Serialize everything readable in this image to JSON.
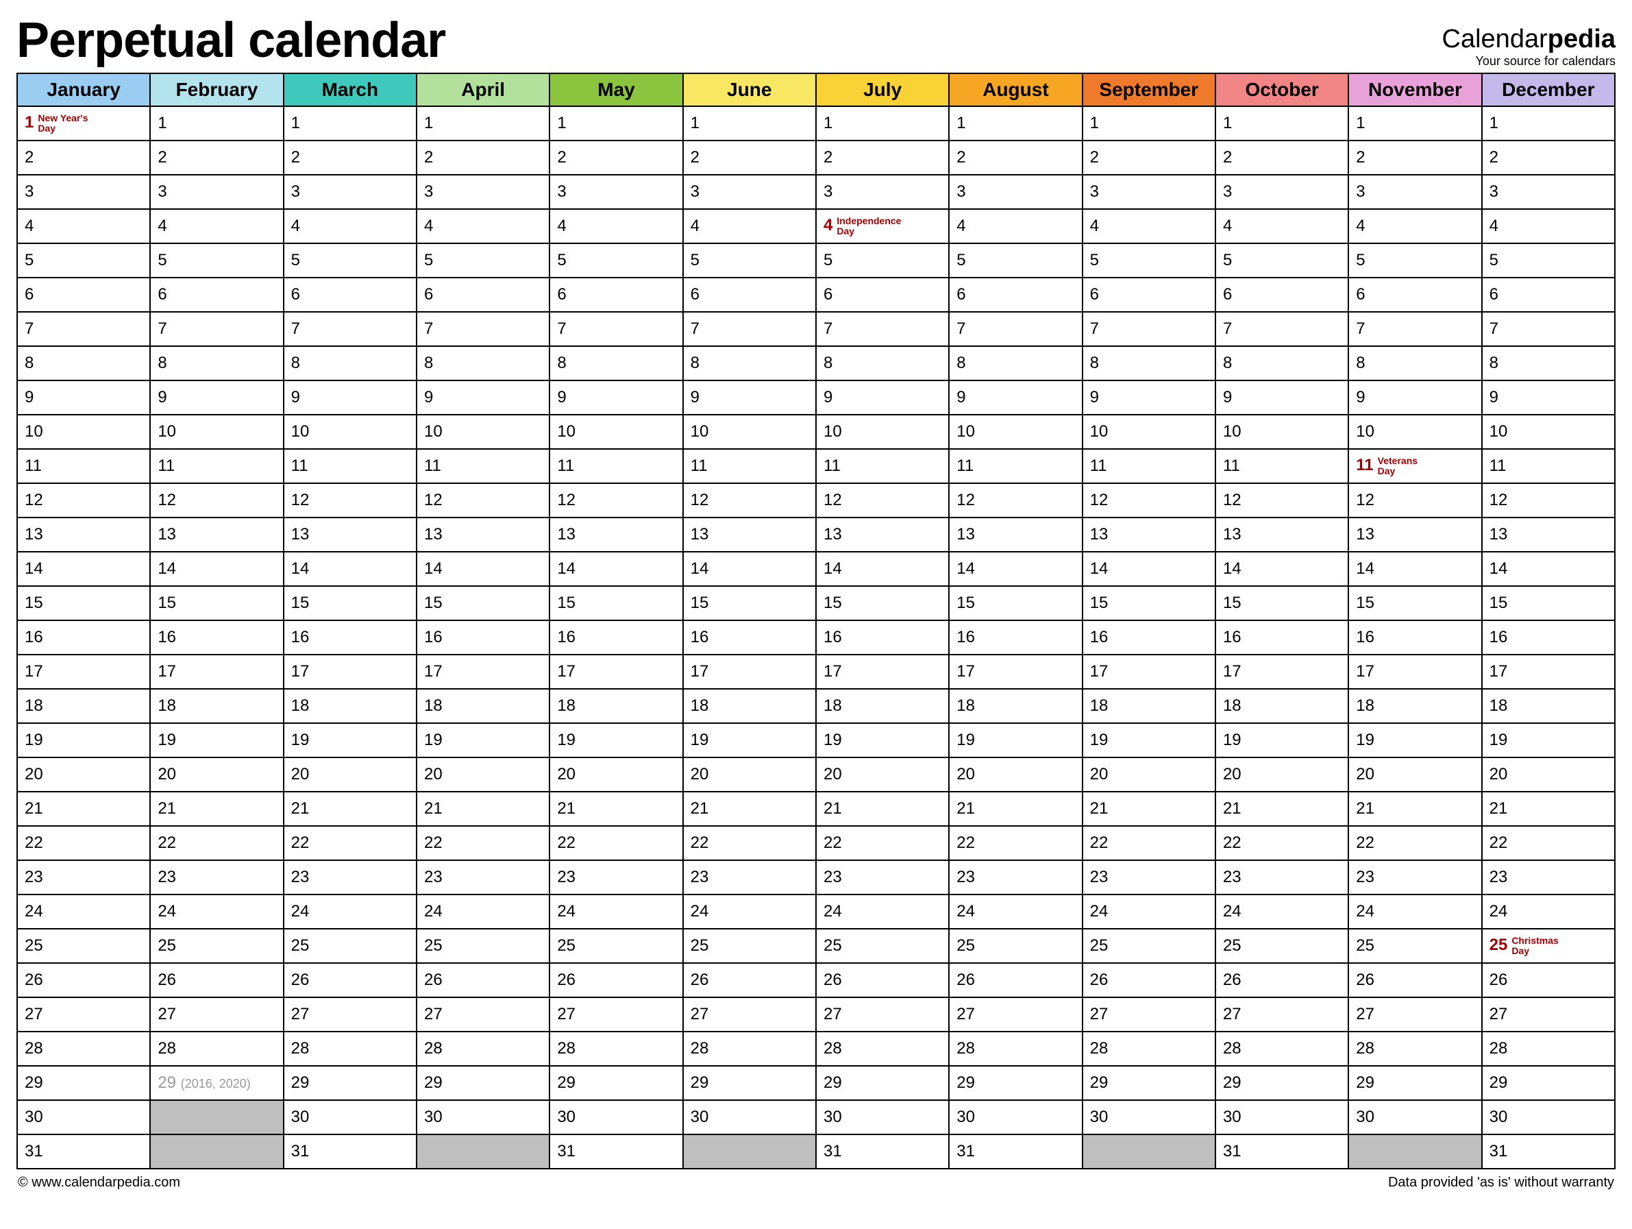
{
  "title": "Perpetual calendar",
  "brand": {
    "prefix": "Calendar",
    "bold": "pedia",
    "subtitle": "Your source for calendars"
  },
  "months": [
    {
      "name": "January",
      "color": "#9bcdf3",
      "days": 31
    },
    {
      "name": "February",
      "color": "#b3e3ed",
      "days": 29
    },
    {
      "name": "March",
      "color": "#3fc9bd",
      "days": 31
    },
    {
      "name": "April",
      "color": "#b2e19b",
      "days": 30
    },
    {
      "name": "May",
      "color": "#8bc53f",
      "days": 31
    },
    {
      "name": "June",
      "color": "#f8e762",
      "days": 30
    },
    {
      "name": "July",
      "color": "#f9d236",
      "days": 31
    },
    {
      "name": "August",
      "color": "#f6a623",
      "days": 31
    },
    {
      "name": "September",
      "color": "#f07a2b",
      "days": 30
    },
    {
      "name": "October",
      "color": "#f18585",
      "days": 31
    },
    {
      "name": "November",
      "color": "#e9a2d9",
      "days": 30
    },
    {
      "name": "December",
      "color": "#c5b8eb",
      "days": 31
    }
  ],
  "max_days": 31,
  "holidays": [
    {
      "month": 0,
      "day": 1,
      "label": "New Year's Day"
    },
    {
      "month": 6,
      "day": 4,
      "label": "Independence Day"
    },
    {
      "month": 10,
      "day": 11,
      "label": "Veterans Day"
    },
    {
      "month": 11,
      "day": 25,
      "label": "Christmas Day"
    }
  ],
  "feb29_note": "(2016, 2020)",
  "footer": {
    "left": "© www.calendarpedia.com",
    "right": "Data provided 'as is' without warranty"
  }
}
